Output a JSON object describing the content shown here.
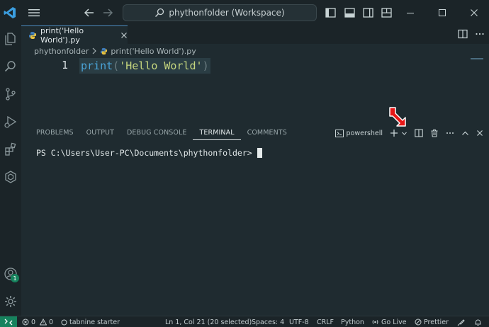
{
  "titlebar": {
    "search_text": "phythonfolder (Workspace)"
  },
  "editor": {
    "tab_label": "print('Hello World').py",
    "breadcrumb": {
      "folder": "phythonfolder",
      "file": "print('Hello World').py"
    },
    "line_number": "1",
    "code": {
      "keyword": "print",
      "open_paren": "(",
      "string": "'Hello World'",
      "close_paren": ")"
    }
  },
  "panel": {
    "tabs": [
      {
        "label": "PROBLEMS"
      },
      {
        "label": "OUTPUT"
      },
      {
        "label": "DEBUG CONSOLE"
      },
      {
        "label": "TERMINAL"
      },
      {
        "label": "COMMENTS"
      }
    ],
    "shell_label": "powershell",
    "terminal_prompt": "PS C:\\Users\\User-PC\\Documents\\phythonfolder>"
  },
  "activitybar": {
    "accounts_badge": "1"
  },
  "statusbar": {
    "errors": "0",
    "warnings": "0",
    "tabnine": "tabnine starter",
    "position": "Ln 1, Col 21 (20 selected)",
    "spaces": "Spaces: 4",
    "encoding": "UTF-8",
    "eol": "CRLF",
    "language": "Python",
    "golive": "Go Live",
    "prettier": "Prettier"
  },
  "colors": {
    "background": "#1f2b30",
    "chrome": "#1b2428",
    "accent": "#4c8bbf",
    "remote": "#16825d",
    "arrow": "#e81717"
  }
}
